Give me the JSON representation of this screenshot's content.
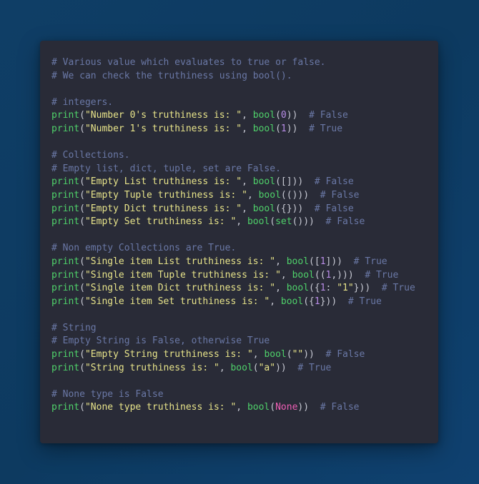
{
  "colors": {
    "background": "#0f3e66",
    "card": "#292b37",
    "comment": "#6a78a6",
    "function": "#4fd16a",
    "string": "#e8e48a",
    "number": "#b98ee8",
    "constant": "#f05fb6",
    "punctuation": "#c7c9d3"
  },
  "code_lines": [
    [
      {
        "t": "cm",
        "v": "# Various value which evaluates to true or false."
      }
    ],
    [
      {
        "t": "cm",
        "v": "# We can check the truthiness using bool()."
      }
    ],
    [],
    [
      {
        "t": "cm",
        "v": "# integers."
      }
    ],
    [
      {
        "t": "fn",
        "v": "print"
      },
      {
        "t": "pn",
        "v": "("
      },
      {
        "t": "st",
        "v": "\"Number 0's truthiness is: \""
      },
      {
        "t": "pn",
        "v": ", "
      },
      {
        "t": "fn",
        "v": "bool"
      },
      {
        "t": "pn",
        "v": "("
      },
      {
        "t": "nm",
        "v": "0"
      },
      {
        "t": "pn",
        "v": "))"
      },
      {
        "t": "pn",
        "v": "  "
      },
      {
        "t": "cm",
        "v": "# False"
      }
    ],
    [
      {
        "t": "fn",
        "v": "print"
      },
      {
        "t": "pn",
        "v": "("
      },
      {
        "t": "st",
        "v": "\"Number 1's truthiness is: \""
      },
      {
        "t": "pn",
        "v": ", "
      },
      {
        "t": "fn",
        "v": "bool"
      },
      {
        "t": "pn",
        "v": "("
      },
      {
        "t": "nm",
        "v": "1"
      },
      {
        "t": "pn",
        "v": "))"
      },
      {
        "t": "pn",
        "v": "  "
      },
      {
        "t": "cm",
        "v": "# True"
      }
    ],
    [],
    [
      {
        "t": "cm",
        "v": "# Collections."
      }
    ],
    [
      {
        "t": "cm",
        "v": "# Empty list, dict, tuple, set are False."
      }
    ],
    [
      {
        "t": "fn",
        "v": "print"
      },
      {
        "t": "pn",
        "v": "("
      },
      {
        "t": "st",
        "v": "\"Empty List truthiness is: \""
      },
      {
        "t": "pn",
        "v": ", "
      },
      {
        "t": "fn",
        "v": "bool"
      },
      {
        "t": "pn",
        "v": "([]))"
      },
      {
        "t": "pn",
        "v": "  "
      },
      {
        "t": "cm",
        "v": "# False"
      }
    ],
    [
      {
        "t": "fn",
        "v": "print"
      },
      {
        "t": "pn",
        "v": "("
      },
      {
        "t": "st",
        "v": "\"Empty Tuple truthiness is: \""
      },
      {
        "t": "pn",
        "v": ", "
      },
      {
        "t": "fn",
        "v": "bool"
      },
      {
        "t": "pn",
        "v": "(()))"
      },
      {
        "t": "pn",
        "v": "  "
      },
      {
        "t": "cm",
        "v": "# False"
      }
    ],
    [
      {
        "t": "fn",
        "v": "print"
      },
      {
        "t": "pn",
        "v": "("
      },
      {
        "t": "st",
        "v": "\"Empty Dict truthiness is: \""
      },
      {
        "t": "pn",
        "v": ", "
      },
      {
        "t": "fn",
        "v": "bool"
      },
      {
        "t": "pn",
        "v": "({}))"
      },
      {
        "t": "pn",
        "v": "  "
      },
      {
        "t": "cm",
        "v": "# False"
      }
    ],
    [
      {
        "t": "fn",
        "v": "print"
      },
      {
        "t": "pn",
        "v": "("
      },
      {
        "t": "st",
        "v": "\"Empty Set truthiness is: \""
      },
      {
        "t": "pn",
        "v": ", "
      },
      {
        "t": "fn",
        "v": "bool"
      },
      {
        "t": "pn",
        "v": "("
      },
      {
        "t": "fn",
        "v": "set"
      },
      {
        "t": "pn",
        "v": "()))"
      },
      {
        "t": "pn",
        "v": "  "
      },
      {
        "t": "cm",
        "v": "# False"
      }
    ],
    [],
    [
      {
        "t": "cm",
        "v": "# Non empty Collections are True."
      }
    ],
    [
      {
        "t": "fn",
        "v": "print"
      },
      {
        "t": "pn",
        "v": "("
      },
      {
        "t": "st",
        "v": "\"Single item List truthiness is: \""
      },
      {
        "t": "pn",
        "v": ", "
      },
      {
        "t": "fn",
        "v": "bool"
      },
      {
        "t": "pn",
        "v": "(["
      },
      {
        "t": "nm",
        "v": "1"
      },
      {
        "t": "pn",
        "v": "]))"
      },
      {
        "t": "pn",
        "v": "  "
      },
      {
        "t": "cm",
        "v": "# True"
      }
    ],
    [
      {
        "t": "fn",
        "v": "print"
      },
      {
        "t": "pn",
        "v": "("
      },
      {
        "t": "st",
        "v": "\"Single item Tuple truthiness is: \""
      },
      {
        "t": "pn",
        "v": ", "
      },
      {
        "t": "fn",
        "v": "bool"
      },
      {
        "t": "pn",
        "v": "(("
      },
      {
        "t": "nm",
        "v": "1"
      },
      {
        "t": "pn",
        "v": ",)))"
      },
      {
        "t": "pn",
        "v": "  "
      },
      {
        "t": "cm",
        "v": "# True"
      }
    ],
    [
      {
        "t": "fn",
        "v": "print"
      },
      {
        "t": "pn",
        "v": "("
      },
      {
        "t": "st",
        "v": "\"Single item Dict truthiness is: \""
      },
      {
        "t": "pn",
        "v": ", "
      },
      {
        "t": "fn",
        "v": "bool"
      },
      {
        "t": "pn",
        "v": "({"
      },
      {
        "t": "nm",
        "v": "1"
      },
      {
        "t": "pn",
        "v": ": "
      },
      {
        "t": "st",
        "v": "\"1\""
      },
      {
        "t": "pn",
        "v": "}))"
      },
      {
        "t": "pn",
        "v": "  "
      },
      {
        "t": "cm",
        "v": "# True"
      }
    ],
    [
      {
        "t": "fn",
        "v": "print"
      },
      {
        "t": "pn",
        "v": "("
      },
      {
        "t": "st",
        "v": "\"Single item Set truthiness is: \""
      },
      {
        "t": "pn",
        "v": ", "
      },
      {
        "t": "fn",
        "v": "bool"
      },
      {
        "t": "pn",
        "v": "({"
      },
      {
        "t": "nm",
        "v": "1"
      },
      {
        "t": "pn",
        "v": "}))"
      },
      {
        "t": "pn",
        "v": "  "
      },
      {
        "t": "cm",
        "v": "# True"
      }
    ],
    [],
    [
      {
        "t": "cm",
        "v": "# String"
      }
    ],
    [
      {
        "t": "cm",
        "v": "# Empty String is False, otherwise True"
      }
    ],
    [
      {
        "t": "fn",
        "v": "print"
      },
      {
        "t": "pn",
        "v": "("
      },
      {
        "t": "st",
        "v": "\"Empty String truthiness is: \""
      },
      {
        "t": "pn",
        "v": ", "
      },
      {
        "t": "fn",
        "v": "bool"
      },
      {
        "t": "pn",
        "v": "("
      },
      {
        "t": "st",
        "v": "\"\""
      },
      {
        "t": "pn",
        "v": "))"
      },
      {
        "t": "pn",
        "v": "  "
      },
      {
        "t": "cm",
        "v": "# False"
      }
    ],
    [
      {
        "t": "fn",
        "v": "print"
      },
      {
        "t": "pn",
        "v": "("
      },
      {
        "t": "st",
        "v": "\"String truthiness is: \""
      },
      {
        "t": "pn",
        "v": ", "
      },
      {
        "t": "fn",
        "v": "bool"
      },
      {
        "t": "pn",
        "v": "("
      },
      {
        "t": "st",
        "v": "\"a\""
      },
      {
        "t": "pn",
        "v": "))"
      },
      {
        "t": "pn",
        "v": "  "
      },
      {
        "t": "cm",
        "v": "# True"
      }
    ],
    [],
    [
      {
        "t": "cm",
        "v": "# None type is False"
      }
    ],
    [
      {
        "t": "fn",
        "v": "print"
      },
      {
        "t": "pn",
        "v": "("
      },
      {
        "t": "st",
        "v": "\"None type truthiness is: \""
      },
      {
        "t": "pn",
        "v": ", "
      },
      {
        "t": "fn",
        "v": "bool"
      },
      {
        "t": "pn",
        "v": "("
      },
      {
        "t": "kw",
        "v": "None"
      },
      {
        "t": "pn",
        "v": "))"
      },
      {
        "t": "pn",
        "v": "  "
      },
      {
        "t": "cm",
        "v": "# False"
      }
    ]
  ]
}
